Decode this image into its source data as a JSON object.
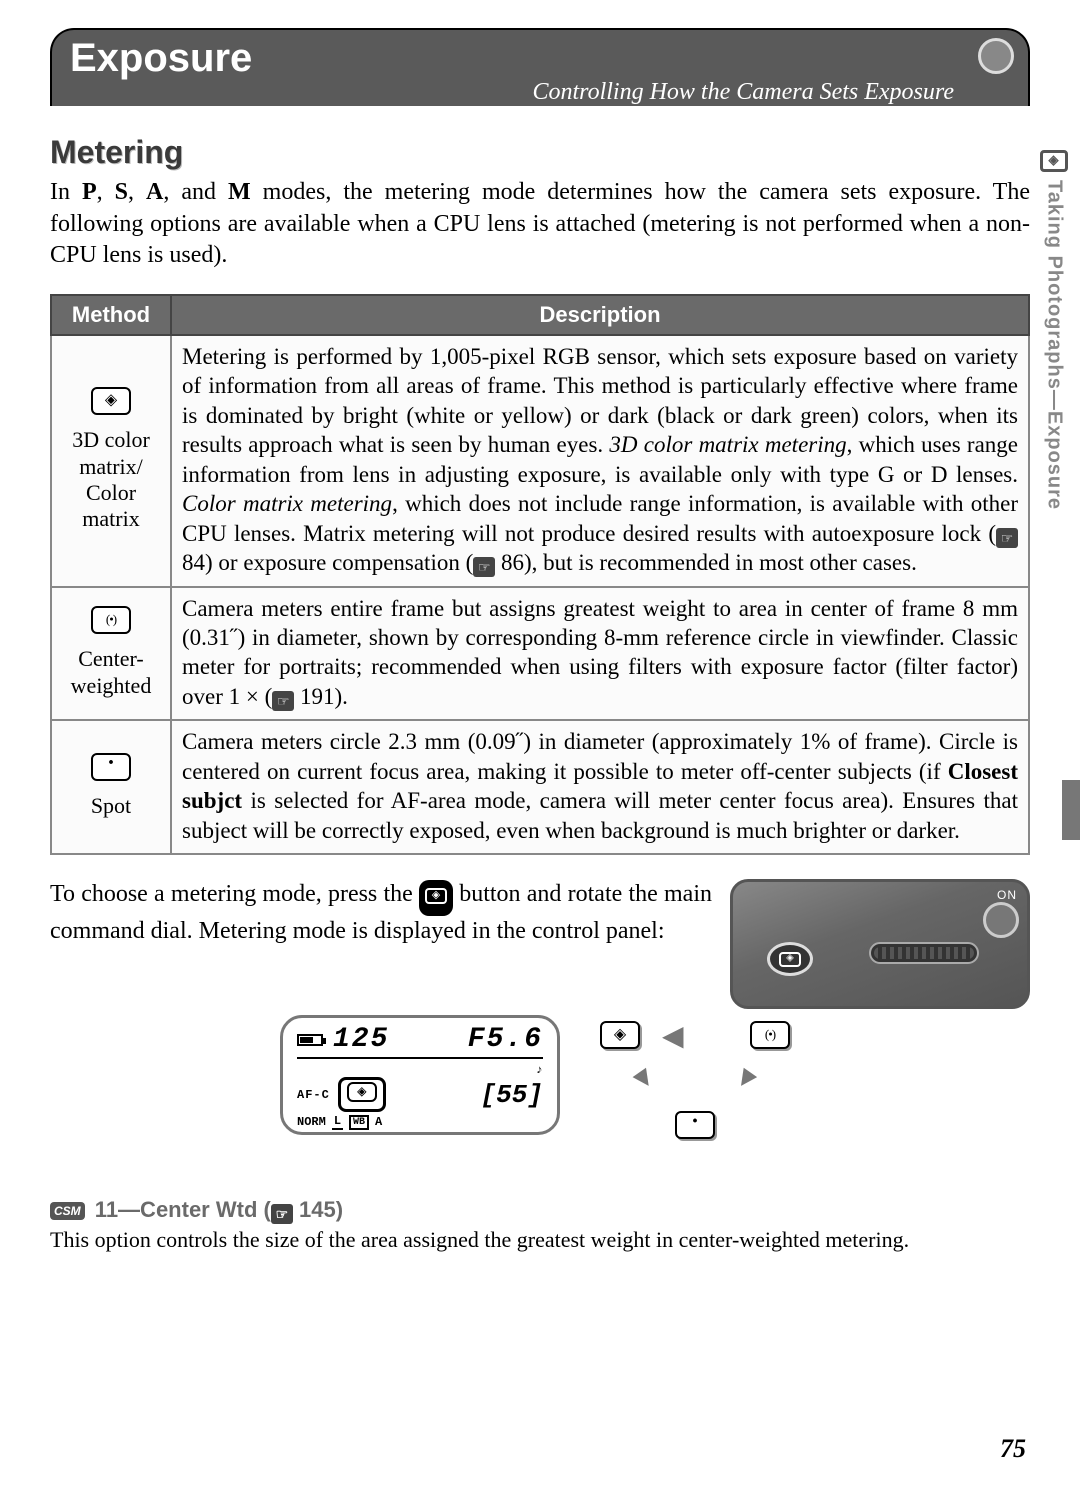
{
  "banner": {
    "title": "Exposure",
    "subtitle": "Controlling How the Camera Sets Exposure"
  },
  "section": {
    "heading": "Metering",
    "intro_html": "In <b>P</b>, <b>S</b>, <b>A</b>, and <b>M</b> modes, the metering mode determines how the camera sets exposure.  The following options are available when a CPU lens is attached (metering is not performed when a non-CPU lens is used)."
  },
  "table": {
    "headers": {
      "method": "Method",
      "description": "Description"
    },
    "rows": [
      {
        "icon": "matrix",
        "method_label": "3D color matrix/ Color matrix",
        "desc_html": "Metering is performed by 1,005-pixel RGB sensor, which sets exposure based on variety of information from all areas of frame.  This method is particularly effective where frame is dominated by bright (white or yellow) or dark (black or dark green) colors, when its results approach what is seen by human eyes.  <i>3D color matrix metering</i>, which uses range information from lens in adjusting exposure, is available only with type G or D lenses.  <i>Color matrix metering</i>, which does not include range information, is available with other CPU lenses.  Matrix metering will not produce desired results with autoexposure lock (<span class='ref-icon' data-name='page-ref-icon'>☞</span> 84) or exposure compensation (<span class='ref-icon' data-name='page-ref-icon'>☞</span> 86), but is recommended in most other cases."
      },
      {
        "icon": "center",
        "method_label": "Center-weighted",
        "desc_html": "Camera meters entire frame but assigns greatest weight to area in center of frame 8 mm (0.31˝) in diameter, shown by corresponding 8-mm reference circle in viewfinder.  Classic meter for portraits; recommended when using filters with exposure factor (filter factor) over 1 × (<span class='ref-icon' data-name='page-ref-icon'>☞</span> 191)."
      },
      {
        "icon": "spot",
        "method_label": "Spot",
        "desc_html": "Camera meters circle 2.3 mm (0.09˝) in diameter (approximately 1% of frame).  Circle is centered on current focus area, making it possible to meter off-center subjects (if <b>Closest subjct</b> is selected for AF-area mode, camera will meter center focus area).  Ensures that subject will be correctly exposed, even when background is much brighter or darker."
      }
    ]
  },
  "below_text_html": "To choose a metering mode, press the <span class='btn-icon' data-name='metering-button-icon'><span></span></span> button and rotate the main command dial.  Metering mode is displayed in the control panel:",
  "lcd": {
    "shutter": "125",
    "aperture": "F5.6",
    "afc": "AF-C",
    "remaining": "55",
    "norm": "NORM",
    "size": "L",
    "wb": "WB",
    "wbmode": "A"
  },
  "cam": {
    "on": "ON"
  },
  "note": {
    "heading": "11—Center Wtd",
    "page_ref": "145",
    "text": "This option controls the size of the area assigned the greatest weight in center-weighted metering."
  },
  "side_tab": "Taking Photographs—Exposure",
  "page_number": "75"
}
